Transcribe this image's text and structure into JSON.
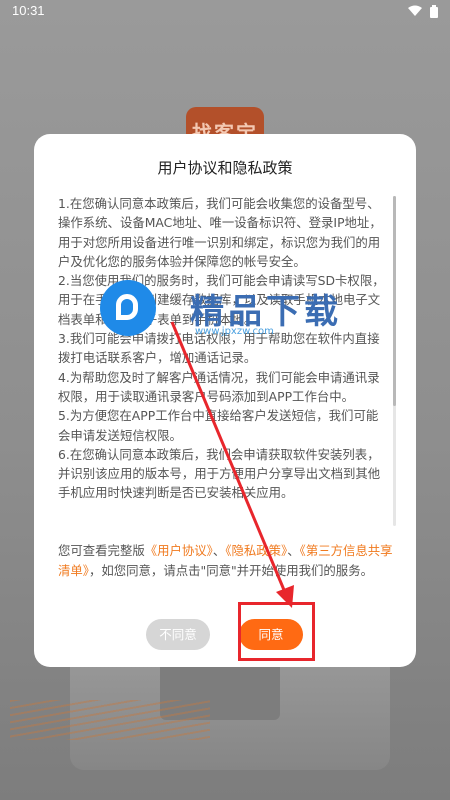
{
  "status_bar": {
    "time": "10:31",
    "icons": [
      "wifi-icon",
      "battery-icon"
    ]
  },
  "background": {
    "logo_text": "找客宝"
  },
  "dialog": {
    "title": "用户协议和隐私政策",
    "terms": [
      "1.在您确认同意本政策后，我们可能会收集您的设备型号、操作系统、设备MAC地址、唯一设备标识符、登录IP地址，用于对您所用设备进行唯一识别和绑定，标识您为我们的用户及优化您的服务体验并保障您的帐号安全。",
      "2.当您使用我们的服务时，我们可能会申请读写SD卡权限，用于在手机本地创建缓存数据库，以及读取手机本地电子文档表单和导出电子表单到手机本地。",
      "3.我们可能会申请拨打电话权限，用于帮助您在软件内直接拨打电话联系客户，增加通话记录。",
      "4.为帮助您及时了解客户通话情况，我们可能会申请通讯录权限，用于读取通讯录客户号码添加到APP工作台中。",
      "5.为方便您在APP工作台中直接给客户发送短信，我们可能会申请发送短信权限。",
      "6.在您确认同意本政策后，我们会申请获取软件安装列表，并识别该应用的版本号，用于方便用户分享导出文档到其他手机应用时快速判断是否已安装相关应用。"
    ],
    "summary": {
      "prefix": "您可查看完整版",
      "link_user": "《用户协议》",
      "sep1": "、",
      "link_privacy": "《隐私政策》",
      "sep2": "、",
      "link_third": "《第三方信息共享清单》",
      "suffix": "，如您同意，请点击\"同意\"并开始使用我们的服务。"
    },
    "disagree_label": "不同意",
    "agree_label": "同意"
  },
  "watermark": {
    "text": "精品下载",
    "url": "www.jpxzw.com"
  },
  "colors": {
    "accent": "#ff6a13",
    "link": "#f07a1f",
    "annotation": "#e8262c"
  }
}
